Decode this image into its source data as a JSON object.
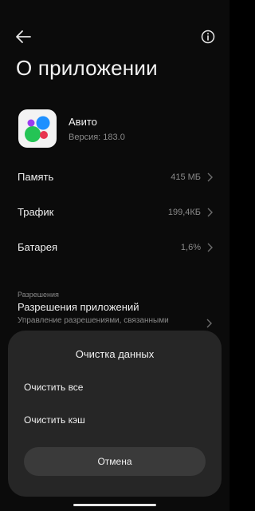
{
  "header": {
    "title": "О приложении"
  },
  "app": {
    "name": "Авито",
    "version": "Версия: 183.0"
  },
  "rows": [
    {
      "label": "Память",
      "value": "415 МБ"
    },
    {
      "label": "Трафик",
      "value": "199,4КБ"
    },
    {
      "label": "Батарея",
      "value": "1,6%"
    }
  ],
  "permissions": {
    "section_label": "Разрешения",
    "title": "Разрешения приложений",
    "description": "Управление разрешениями, связанными"
  },
  "dialog": {
    "title": "Очистка данных",
    "clear_all": "Очистить все",
    "clear_cache": "Очистить кэш",
    "cancel": "Отмена"
  },
  "colors": {
    "background": "#0b0b0b",
    "sheet": "#262626",
    "icon_blue": "#1e90ff",
    "icon_green": "#24c455",
    "icon_purple": "#9b3df0",
    "icon_red": "#e8344f"
  }
}
